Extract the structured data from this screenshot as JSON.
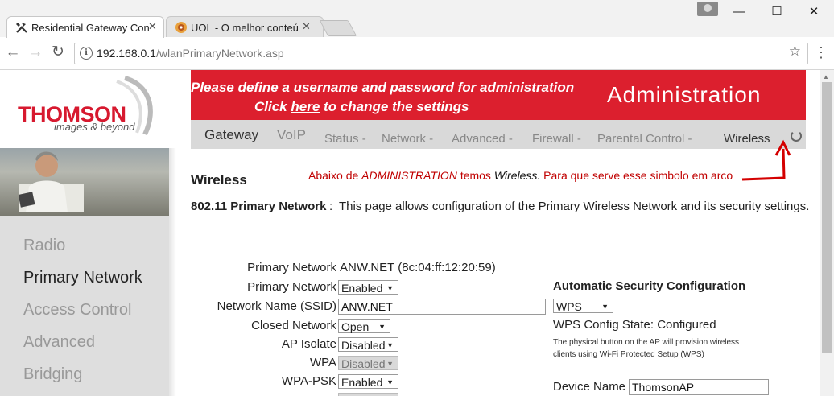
{
  "browser": {
    "tabs": [
      {
        "title": "Residential Gateway Con",
        "icon": "tools-icon",
        "active": true
      },
      {
        "title": "UOL - O melhor conteúd",
        "icon": "uol-icon",
        "active": false
      }
    ],
    "url_host": "192.168.0.1",
    "url_path": "/wlanPrimaryNetwork.asp"
  },
  "header": {
    "logo": "THOMSON",
    "tagline": "images & beyond",
    "message_line1": "Please define a username and password for administration",
    "message_click": "Click",
    "message_here": "here",
    "message_rest": "to change the settings",
    "section": "Administration"
  },
  "nav": {
    "primary": [
      "Gateway",
      "VoIP"
    ],
    "secondary": [
      "Status -",
      "Network -",
      "Advanced -",
      "Firewall -",
      "Parental Control -",
      "Wireless"
    ]
  },
  "sidebar": {
    "items": [
      "Radio",
      "Primary Network",
      "Access Control",
      "Advanced",
      "Bridging"
    ],
    "selected": "Primary Network"
  },
  "page": {
    "title": "Wireless",
    "note_part1": "Abaixo de",
    "note_admin": "ADMINISTRATION",
    "note_part2": "temos",
    "note_wireless": "Wireless.",
    "note_part3": "Para que serve esse simbolo em arco",
    "desc_label": "802.11 Primary Network",
    "desc_colon": ":",
    "desc_text": "This page allows configuration of the Primary Wireless Network and its security settings."
  },
  "form": {
    "primary_network_info_label": "Primary Network",
    "primary_network_info_value": "ANW.NET (8c:04:ff:12:20:59)",
    "primary_network_label": "Primary Network",
    "primary_network_value": "Enabled",
    "ssid_label": "Network Name (SSID)",
    "ssid_value": "ANW.NET",
    "closed_network_label": "Closed Network",
    "closed_network_value": "Open",
    "ap_isolate_label": "AP Isolate",
    "ap_isolate_value": "Disabled",
    "wpa_label": "WPA",
    "wpa_value": "Disabled",
    "wpa_psk_label": "WPA-PSK",
    "wpa_psk_value": "Enabled"
  },
  "auto_security": {
    "heading": "Automatic Security Configuration",
    "mode_value": "WPS",
    "state": "WPS Config State: Configured",
    "note": "The physical button on the AP will provision wireless clients using Wi-Fi Protected Setup (WPS)",
    "device_name_label": "Device Name",
    "device_name_value": "ThomsonAP"
  }
}
